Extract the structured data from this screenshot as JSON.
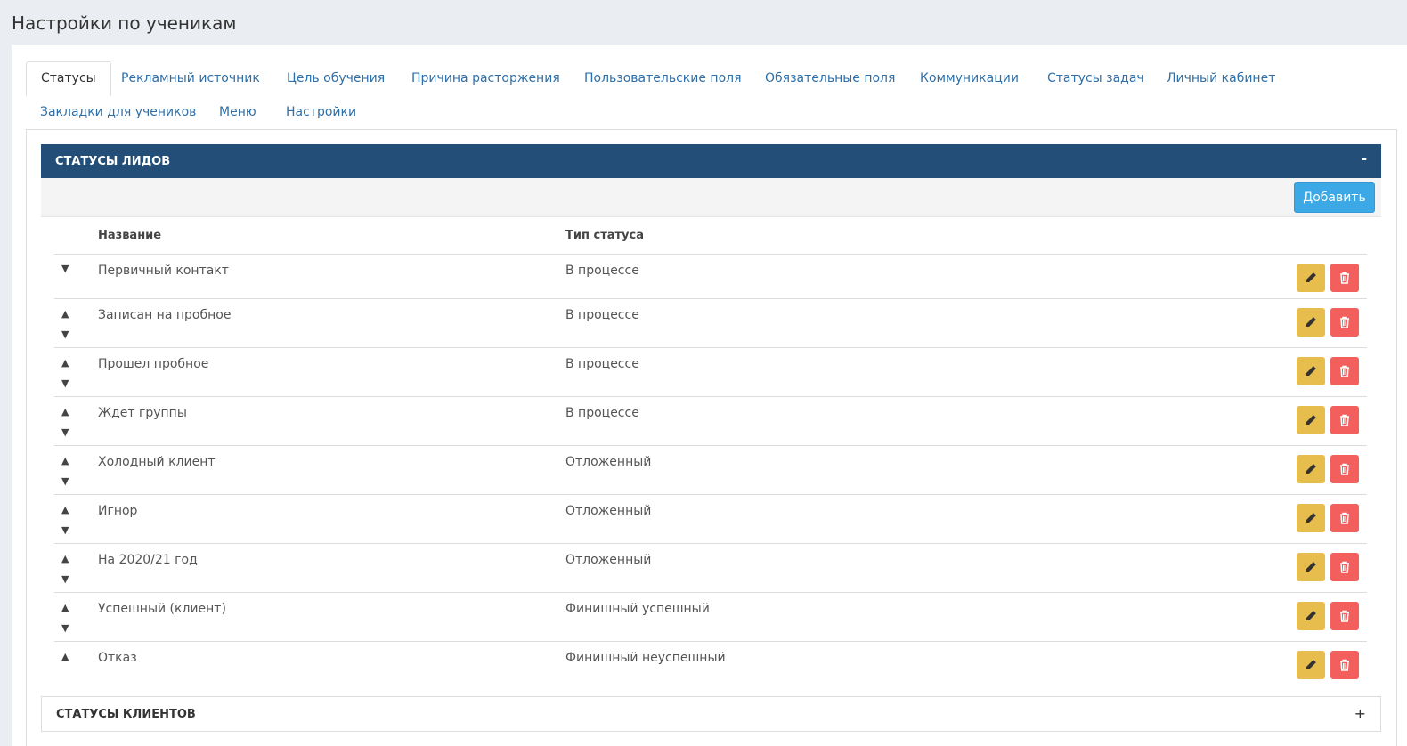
{
  "page": {
    "title": "Настройки по ученикам"
  },
  "tabs": [
    {
      "label": "Статусы"
    },
    {
      "label": "Рекламный источник"
    },
    {
      "label": "Цель обучения"
    },
    {
      "label": "Причина расторжения"
    },
    {
      "label": "Пользовательские поля"
    },
    {
      "label": "Обязательные поля"
    },
    {
      "label": "Коммуникации"
    },
    {
      "label": "Статусы задач"
    },
    {
      "label": "Личный кабинет"
    },
    {
      "label": "Закладки для учеников"
    },
    {
      "label": "Меню"
    },
    {
      "label": "Настройки"
    }
  ],
  "leads_panel": {
    "title": "Статусы лидов",
    "toggle": "-",
    "add_label": "Добавить",
    "columns": {
      "name": "Название",
      "type": "Тип статуса"
    },
    "rows": [
      {
        "name": "Первичный контакт",
        "type": "В процессе"
      },
      {
        "name": "Записан на пробное",
        "type": "В процессе"
      },
      {
        "name": "Прошел пробное",
        "type": "В процессе"
      },
      {
        "name": "Ждет группы",
        "type": "В процессе"
      },
      {
        "name": "Холодный клиент",
        "type": "Отложенный"
      },
      {
        "name": "Игнор",
        "type": "Отложенный"
      },
      {
        "name": "На 2020/21 год",
        "type": "Отложенный"
      },
      {
        "name": "Успешный (клиент)",
        "type": "Финишный успешный"
      },
      {
        "name": "Отказ",
        "type": "Финишный неуспешный"
      }
    ]
  },
  "clients_panel": {
    "title": "Статусы клиентов",
    "toggle": "+"
  },
  "icons": {
    "up": "▲",
    "down": "▼",
    "edit": "pencil-icon",
    "delete": "trash-icon"
  },
  "colors": {
    "header": "#224e78",
    "add": "#3ca8e6",
    "edit": "#e7bd4e",
    "delete": "#f25f5c",
    "link": "#2f6fa8"
  }
}
